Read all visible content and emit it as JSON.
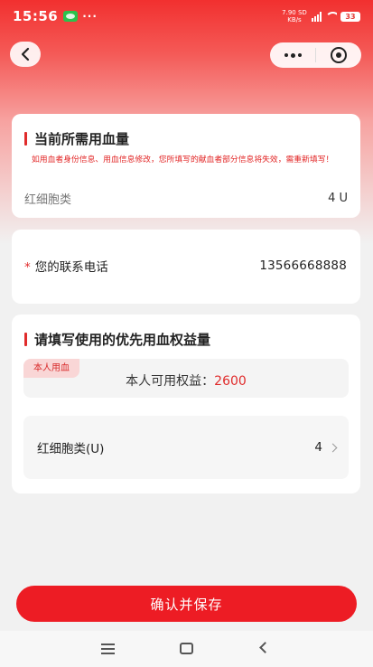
{
  "status_bar": {
    "time": "15:56",
    "dots": "···",
    "net_speed_top": "7.90 SD",
    "net_speed_bottom": "KB/s",
    "battery": "33"
  },
  "nav": {
    "back_icon": "chevron-left-icon",
    "more_icon": "more-dots-icon",
    "close_icon": "target-close-icon"
  },
  "current_blood": {
    "title": "当前所需用血量",
    "notice": "如用血者身份信息、用血信息修改，您所填写的献血者部分信息将失效，需重新填写！",
    "item_label": "红细胞类",
    "item_value": "4 U"
  },
  "contact": {
    "required_mark": "*",
    "label": "您的联系电话",
    "value": "13566668888"
  },
  "priority": {
    "title": "请填写使用的优先用血权益量",
    "tag": "本人用血",
    "benefit_label": "本人可用权益：",
    "benefit_amount": "2600",
    "rbc_label": "红细胞类(U)",
    "rbc_value": "4"
  },
  "confirm_button": "确认并保存",
  "colors": {
    "accent": "#ed1c24",
    "notice_red": "#e22424",
    "page_bg": "#f1f1f1"
  }
}
